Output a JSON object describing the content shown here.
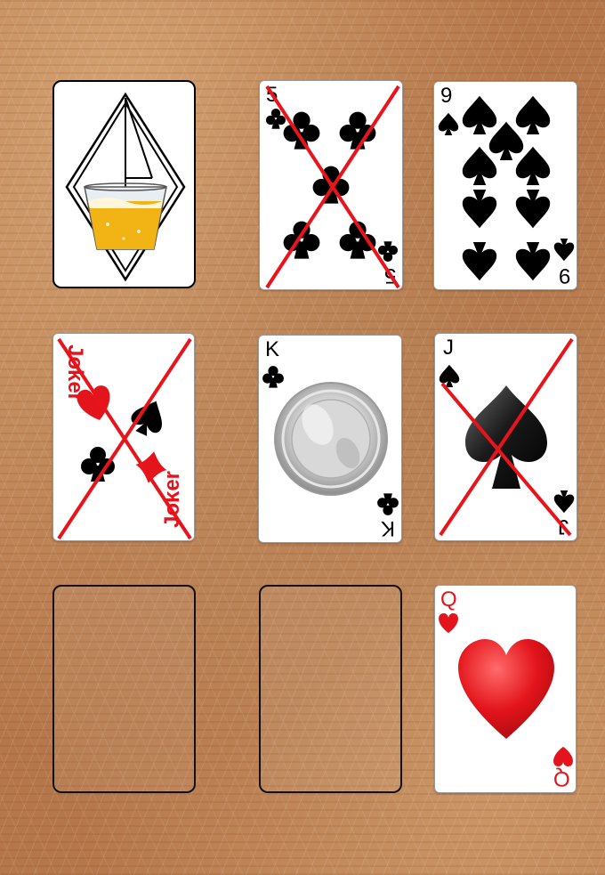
{
  "board": {
    "slots": [
      {
        "id": "slot-1",
        "state": "face-down",
        "back": "beer-glass-diamond-icon"
      },
      {
        "id": "slot-2",
        "state": "face-up",
        "rank": "5",
        "suit": "clubs",
        "crossed": true
      },
      {
        "id": "slot-3",
        "state": "face-up",
        "rank": "9",
        "suit": "spades",
        "crossed": false
      },
      {
        "id": "slot-4",
        "state": "face-up",
        "rank": "Joker",
        "suit": "joker",
        "crossed": true
      },
      {
        "id": "slot-5",
        "state": "face-up",
        "rank": "K",
        "suit": "clubs",
        "crossed": false,
        "center": "shot-glass-icon"
      },
      {
        "id": "slot-6",
        "state": "face-up",
        "rank": "J",
        "suit": "spades",
        "crossed": true
      },
      {
        "id": "slot-7",
        "state": "empty"
      },
      {
        "id": "slot-8",
        "state": "empty"
      },
      {
        "id": "slot-9",
        "state": "face-up",
        "rank": "Q",
        "suit": "hearts",
        "crossed": false
      }
    ]
  },
  "cards": {
    "five_clubs": {
      "rank": "5"
    },
    "nine_spades": {
      "rank": "9"
    },
    "joker": {
      "text": "Joker"
    },
    "king_clubs": {
      "rank": "K"
    },
    "jack_spades": {
      "rank": "J"
    },
    "queen_hearts": {
      "rank": "Q"
    }
  },
  "colors": {
    "table": "#b5774a",
    "cross": "#e8141c",
    "red_suit": "#e3141b",
    "black_suit": "#000000",
    "beer": "#f2b415"
  }
}
